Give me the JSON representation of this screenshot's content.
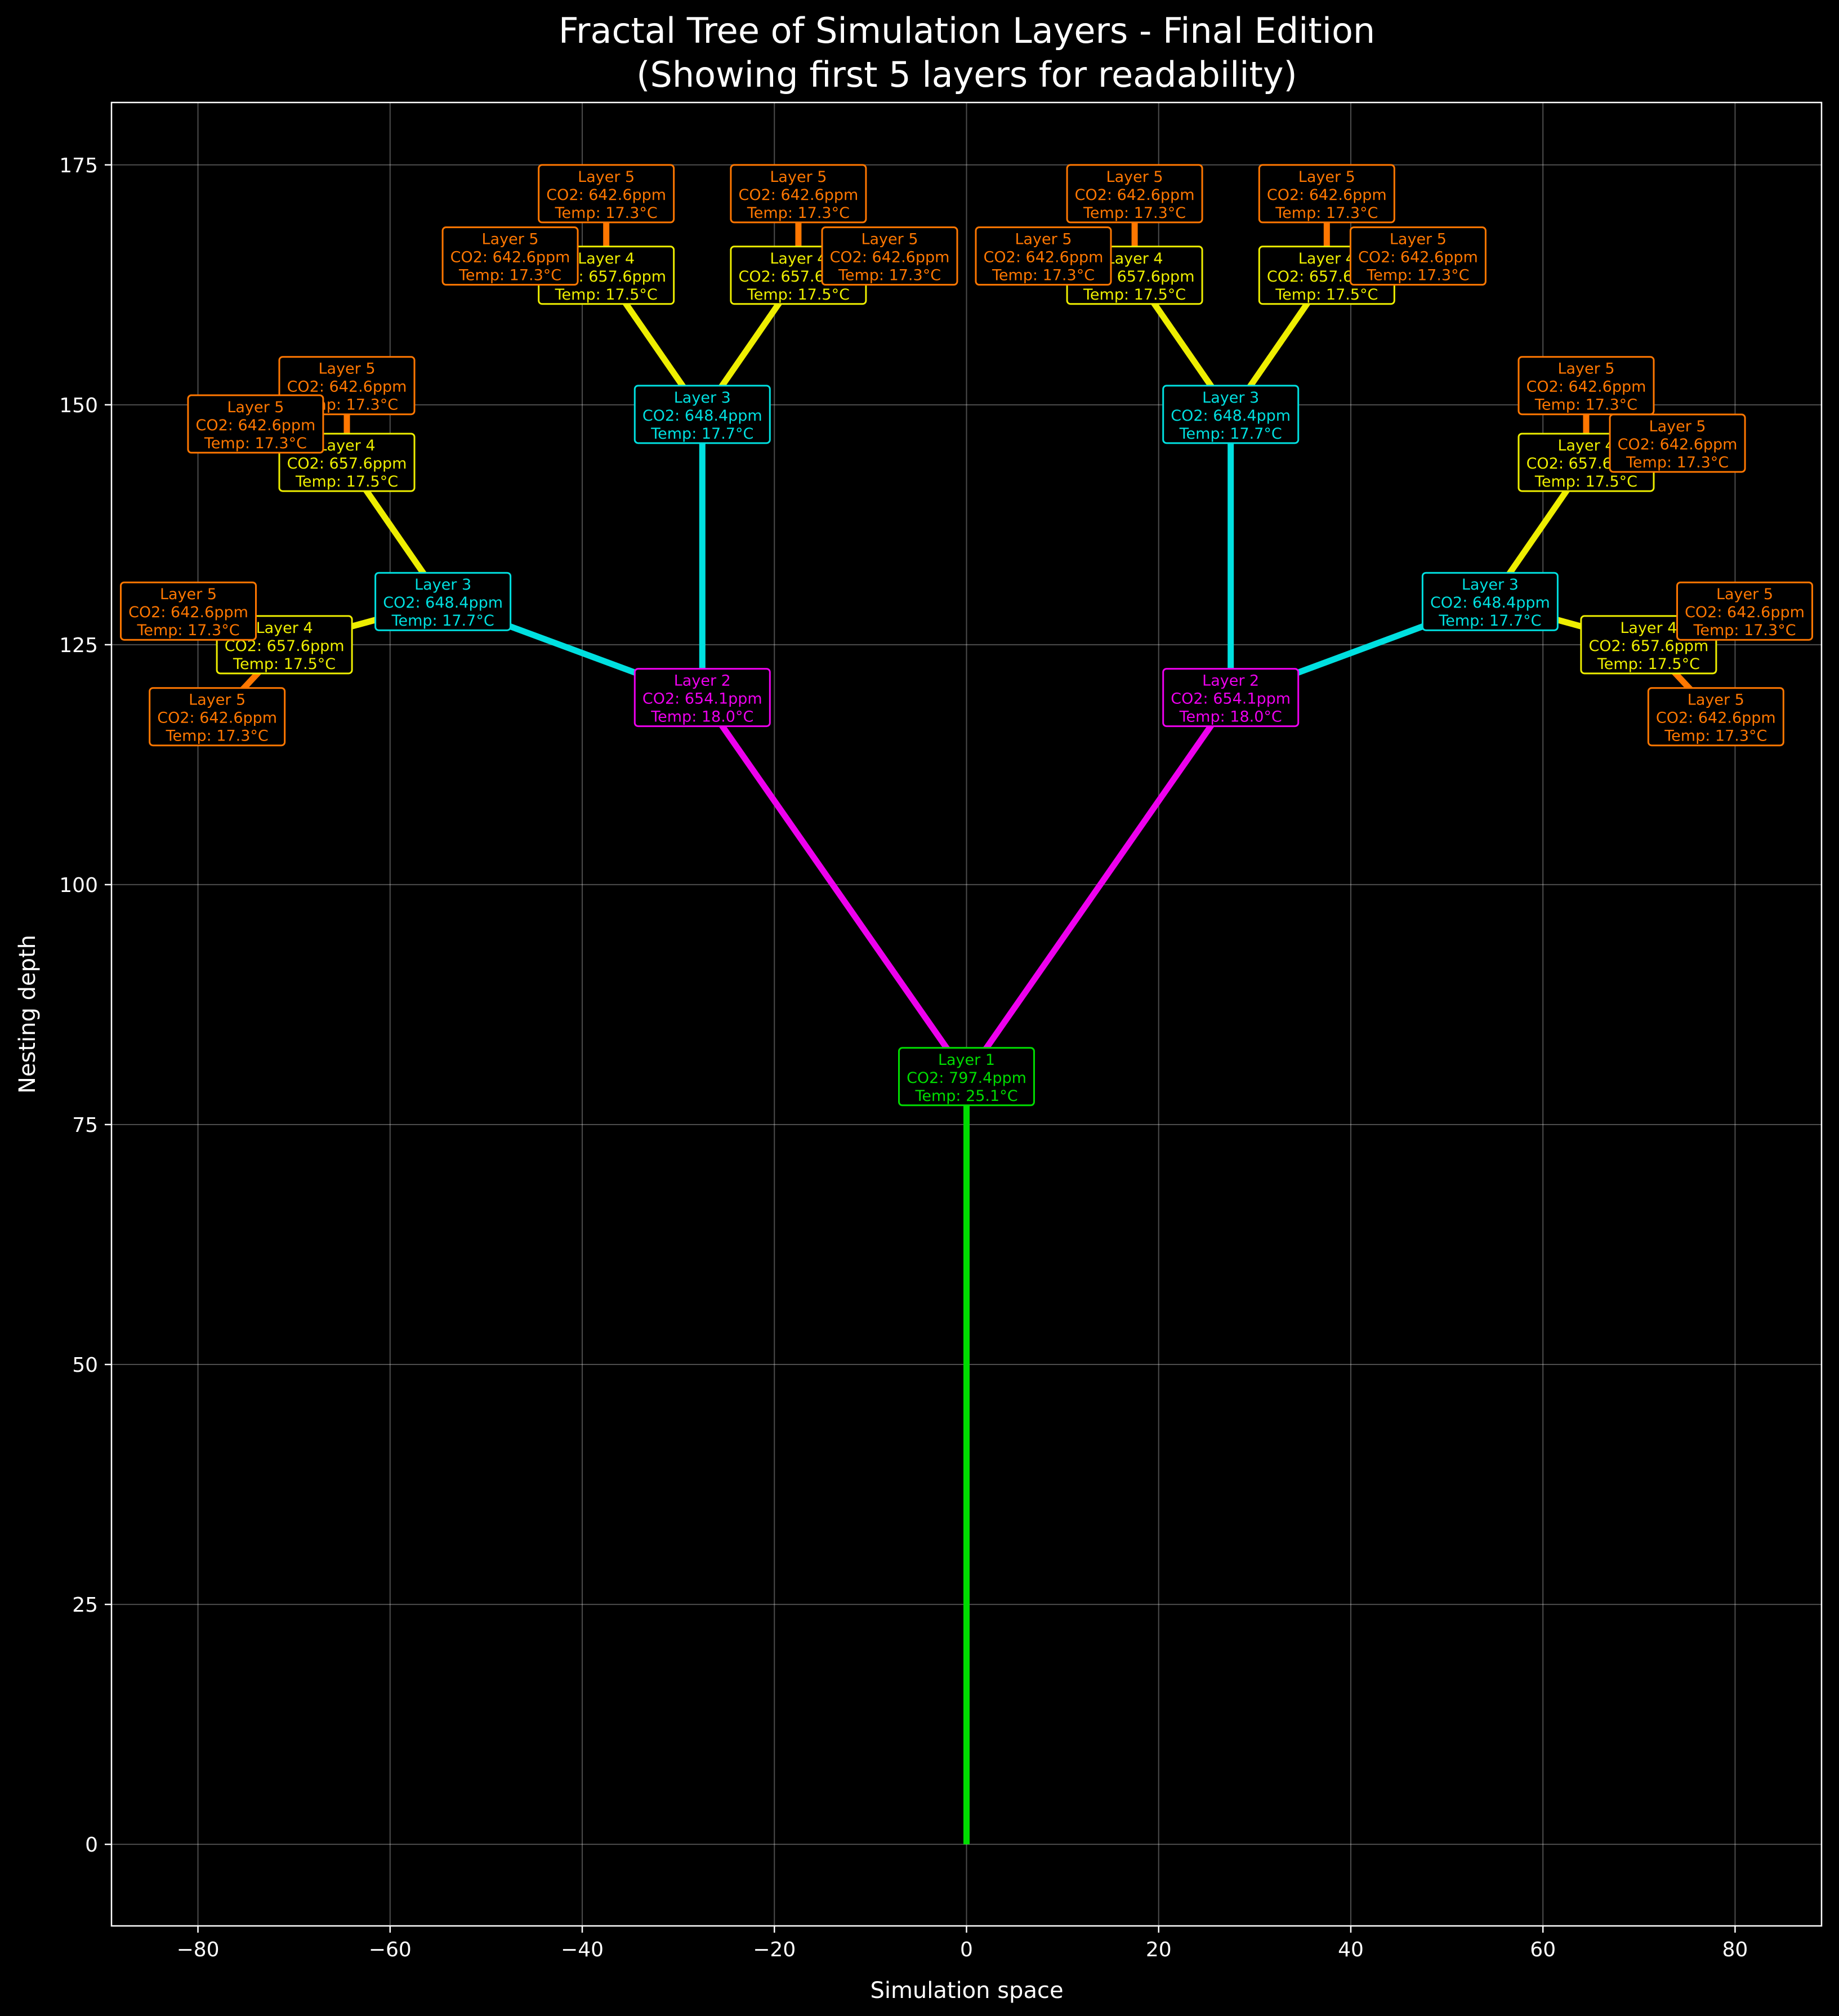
{
  "chart_data": {
    "type": "line",
    "title_line1": "Fractal Tree of Simulation Layers - Final Edition",
    "title_line2": "(Showing first 5 layers for readability)",
    "xlabel": "Simulation space",
    "ylabel": "Nesting depth",
    "xlim": [
      -89,
      89
    ],
    "ylim": [
      -8.5,
      181.5
    ],
    "xticks": [
      -80,
      -60,
      -40,
      -20,
      0,
      20,
      40,
      60,
      80
    ],
    "xtick_labels": [
      "−80",
      "−60",
      "−40",
      "−20",
      "0",
      "20",
      "40",
      "60",
      "80"
    ],
    "yticks": [
      0,
      25,
      50,
      75,
      100,
      125,
      150,
      175
    ],
    "ytick_labels": [
      "0",
      "25",
      "50",
      "75",
      "100",
      "125",
      "150",
      "175"
    ],
    "grid": true,
    "background": "#000000",
    "layer_colors": {
      "1": "#00dd00",
      "2": "#ee00ee",
      "3": "#00e0e0",
      "4": "#eeee00",
      "5": "#ff7700"
    },
    "layer_info": {
      "1": {
        "label": "Layer 1",
        "co2": "CO2: 797.4ppm",
        "temp": "Temp: 25.1°C"
      },
      "2": {
        "label": "Layer 2",
        "co2": "CO2: 654.1ppm",
        "temp": "Temp: 18.0°C"
      },
      "3": {
        "label": "Layer 3",
        "co2": "CO2: 648.4ppm",
        "temp": "Temp: 17.7°C"
      },
      "4": {
        "label": "Layer 4",
        "co2": "CO2: 657.6ppm",
        "temp": "Temp: 17.5°C"
      },
      "5": {
        "label": "Layer 5",
        "co2": "CO2: 642.6ppm",
        "temp": "Temp: 17.3°C"
      }
    },
    "branches": [
      {
        "layer": 1,
        "from": [
          0,
          0
        ],
        "to": [
          0,
          80
        ]
      },
      {
        "layer": 2,
        "from": [
          0,
          80
        ],
        "to": [
          -27.5,
          119.5
        ]
      },
      {
        "layer": 2,
        "from": [
          0,
          80
        ],
        "to": [
          27.5,
          119.5
        ]
      },
      {
        "layer": 3,
        "from": [
          -27.5,
          119.5
        ],
        "to": [
          -27.5,
          149
        ]
      },
      {
        "layer": 3,
        "from": [
          -27.5,
          119.5
        ],
        "to": [
          -54.5,
          129.5
        ]
      },
      {
        "layer": 3,
        "from": [
          27.5,
          119.5
        ],
        "to": [
          27.5,
          149
        ]
      },
      {
        "layer": 3,
        "from": [
          27.5,
          119.5
        ],
        "to": [
          54.5,
          129.5
        ]
      },
      {
        "layer": 4,
        "from": [
          -27.5,
          149
        ],
        "to": [
          -37.5,
          163.5
        ]
      },
      {
        "layer": 4,
        "from": [
          -27.5,
          149
        ],
        "to": [
          -17.5,
          163.5
        ]
      },
      {
        "layer": 4,
        "from": [
          -54.5,
          129.5
        ],
        "to": [
          -64.5,
          144
        ]
      },
      {
        "layer": 4,
        "from": [
          -54.5,
          129.5
        ],
        "to": [
          -71,
          125
        ]
      },
      {
        "layer": 4,
        "from": [
          27.5,
          149
        ],
        "to": [
          17.5,
          163.5
        ]
      },
      {
        "layer": 4,
        "from": [
          27.5,
          149
        ],
        "to": [
          37.5,
          163.5
        ]
      },
      {
        "layer": 4,
        "from": [
          54.5,
          129.5
        ],
        "to": [
          64.5,
          144
        ]
      },
      {
        "layer": 4,
        "from": [
          54.5,
          129.5
        ],
        "to": [
          71,
          125
        ]
      },
      {
        "layer": 5,
        "from": [
          -37.5,
          163.5
        ],
        "to": [
          -37.5,
          172
        ]
      },
      {
        "layer": 5,
        "from": [
          -37.5,
          163.5
        ],
        "to": [
          -47.5,
          165.5
        ]
      },
      {
        "layer": 5,
        "from": [
          -17.5,
          163.5
        ],
        "to": [
          -17.5,
          172
        ]
      },
      {
        "layer": 5,
        "from": [
          -17.5,
          163.5
        ],
        "to": [
          -8,
          165.5
        ]
      },
      {
        "layer": 5,
        "from": [
          -64.5,
          144
        ],
        "to": [
          -64.5,
          152
        ]
      },
      {
        "layer": 5,
        "from": [
          -64.5,
          144
        ],
        "to": [
          -74,
          148
        ]
      },
      {
        "layer": 5,
        "from": [
          -71,
          125
        ],
        "to": [
          -81,
          128.5
        ]
      },
      {
        "layer": 5,
        "from": [
          -71,
          125
        ],
        "to": [
          -78,
          117.5
        ]
      },
      {
        "layer": 5,
        "from": [
          17.5,
          163.5
        ],
        "to": [
          17.5,
          172
        ]
      },
      {
        "layer": 5,
        "from": [
          17.5,
          163.5
        ],
        "to": [
          8,
          165.5
        ]
      },
      {
        "layer": 5,
        "from": [
          37.5,
          163.5
        ],
        "to": [
          37.5,
          172
        ]
      },
      {
        "layer": 5,
        "from": [
          37.5,
          163.5
        ],
        "to": [
          47,
          165.5
        ]
      },
      {
        "layer": 5,
        "from": [
          64.5,
          144
        ],
        "to": [
          64.5,
          152
        ]
      },
      {
        "layer": 5,
        "from": [
          64.5,
          144
        ],
        "to": [
          74,
          146
        ]
      },
      {
        "layer": 5,
        "from": [
          71,
          125
        ],
        "to": [
          81,
          128.5
        ]
      },
      {
        "layer": 5,
        "from": [
          71,
          125
        ],
        "to": [
          78,
          117.5
        ]
      }
    ],
    "nodes": [
      {
        "layer": 1,
        "x": 0,
        "y": 80
      },
      {
        "layer": 2,
        "x": -27.5,
        "y": 119.5
      },
      {
        "layer": 2,
        "x": 27.5,
        "y": 119.5
      },
      {
        "layer": 3,
        "x": -27.5,
        "y": 149
      },
      {
        "layer": 3,
        "x": -54.5,
        "y": 129.5
      },
      {
        "layer": 3,
        "x": 27.5,
        "y": 149
      },
      {
        "layer": 3,
        "x": 54.5,
        "y": 129.5
      },
      {
        "layer": 4,
        "x": -37.5,
        "y": 163.5
      },
      {
        "layer": 4,
        "x": -17.5,
        "y": 163.5
      },
      {
        "layer": 4,
        "x": -64.5,
        "y": 144
      },
      {
        "layer": 4,
        "x": -71,
        "y": 125
      },
      {
        "layer": 4,
        "x": 17.5,
        "y": 163.5
      },
      {
        "layer": 4,
        "x": 37.5,
        "y": 163.5
      },
      {
        "layer": 4,
        "x": 64.5,
        "y": 144
      },
      {
        "layer": 4,
        "x": 71,
        "y": 125
      },
      {
        "layer": 5,
        "x": -37.5,
        "y": 172
      },
      {
        "layer": 5,
        "x": -47.5,
        "y": 165.5
      },
      {
        "layer": 5,
        "x": -17.5,
        "y": 172
      },
      {
        "layer": 5,
        "x": -8,
        "y": 165.5
      },
      {
        "layer": 5,
        "x": -64.5,
        "y": 152
      },
      {
        "layer": 5,
        "x": -74,
        "y": 148
      },
      {
        "layer": 5,
        "x": -81,
        "y": 128.5
      },
      {
        "layer": 5,
        "x": -78,
        "y": 117.5
      },
      {
        "layer": 5,
        "x": 17.5,
        "y": 172
      },
      {
        "layer": 5,
        "x": 8,
        "y": 165.5
      },
      {
        "layer": 5,
        "x": 37.5,
        "y": 172
      },
      {
        "layer": 5,
        "x": 47,
        "y": 165.5
      },
      {
        "layer": 5,
        "x": 64.5,
        "y": 152
      },
      {
        "layer": 5,
        "x": 74,
        "y": 146
      },
      {
        "layer": 5,
        "x": 81,
        "y": 128.5
      },
      {
        "layer": 5,
        "x": 78,
        "y": 117.5
      }
    ]
  }
}
